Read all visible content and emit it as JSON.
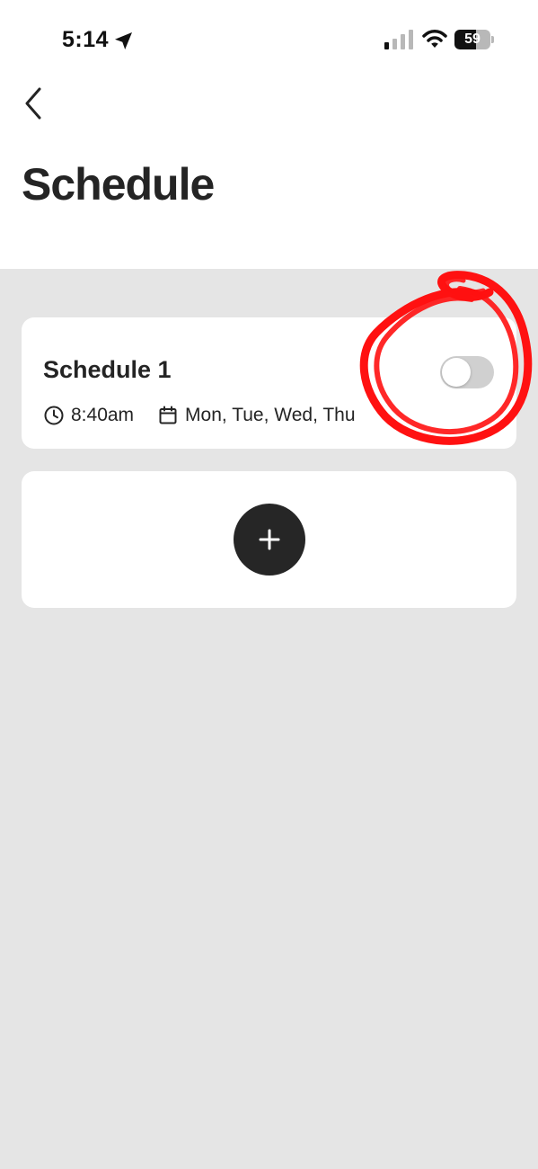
{
  "status_bar": {
    "time": "5:14",
    "battery_percent": "59",
    "battery_level": 0.59,
    "signal_bars_active": 1,
    "signal_bars_total": 4
  },
  "header": {
    "title": "Schedule"
  },
  "schedules": [
    {
      "name": "Schedule 1",
      "time": "8:40am",
      "days": "Mon, Tue, Wed, Thu",
      "enabled": false
    }
  ],
  "colors": {
    "background": "#e5e5e5",
    "card": "#ffffff",
    "text": "#242424",
    "toggle_off": "#d0d0d0",
    "add_button": "#262626",
    "annotation": "#ff1111"
  },
  "icons": {
    "back": "chevron-left-icon",
    "location": "location-arrow-icon",
    "signal": "cellular-signal-icon",
    "wifi": "wifi-icon",
    "battery": "battery-icon",
    "clock": "clock-icon",
    "calendar": "calendar-icon",
    "add": "plus-icon"
  }
}
